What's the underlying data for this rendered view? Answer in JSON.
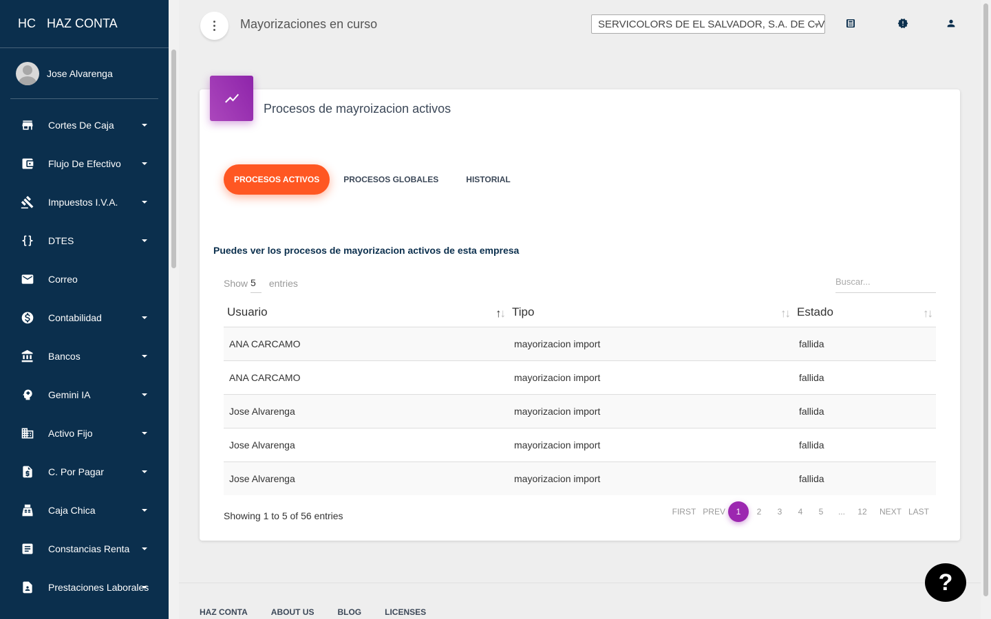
{
  "brand": {
    "mini": "HC",
    "name": "HAZ CONTA"
  },
  "user": {
    "name": "Jose Alvarenga"
  },
  "sidebar": {
    "items": [
      {
        "label": "Cortes De Caja",
        "icon": "store-icon",
        "caret": true
      },
      {
        "label": "Flujo De Efectivo",
        "icon": "wallet-icon",
        "caret": true
      },
      {
        "label": "Impuestos I.V.A.",
        "icon": "gavel-icon",
        "caret": true
      },
      {
        "label": "DTES",
        "icon": "braces-icon",
        "caret": true
      },
      {
        "label": "Correo",
        "icon": "mail-icon",
        "caret": false
      },
      {
        "label": "Contabilidad",
        "icon": "dollar-icon",
        "caret": true
      },
      {
        "label": "Bancos",
        "icon": "bank-icon",
        "caret": true
      },
      {
        "label": "Gemini IA",
        "icon": "brain-icon",
        "caret": true
      },
      {
        "label": "Activo Fijo",
        "icon": "building-icon",
        "caret": true
      },
      {
        "label": "C. Por Pagar",
        "icon": "invoice-icon",
        "caret": true
      },
      {
        "label": "Caja Chica",
        "icon": "register-icon",
        "caret": true
      },
      {
        "label": "Constancias Renta",
        "icon": "document-icon",
        "caret": true
      },
      {
        "label": "Prestaciones Laborales",
        "icon": "badge-icon",
        "caret": true
      }
    ]
  },
  "header": {
    "title": "Mayorizaciones en curso",
    "company": "SERVICOLORS DE EL SALVADOR, S.A. DE C.V."
  },
  "card": {
    "title": "Procesos de mayroizacion activos",
    "tabs": [
      "PROCESOS ACTIVOS",
      "PROCESOS GLOBALES",
      "HISTORIAL"
    ],
    "description": "Puedes ver los procesos de mayorizacion activos de esta empresa",
    "show_label": "Show",
    "show_count": "5",
    "entries_label": "entries",
    "search_placeholder": "Buscar..."
  },
  "table": {
    "headers": [
      "Usuario",
      "Tipo",
      "Estado"
    ],
    "rows": [
      [
        "ANA CARCAMO",
        "mayorizacion import",
        "fallida"
      ],
      [
        "ANA CARCAMO",
        "mayorizacion import",
        "fallida"
      ],
      [
        "Jose Alvarenga",
        "mayorizacion import",
        "fallida"
      ],
      [
        "Jose Alvarenga",
        "mayorizacion import",
        "fallida"
      ],
      [
        "Jose Alvarenga",
        "mayorizacion import",
        "fallida"
      ]
    ],
    "info": "Showing 1 to 5 of 56 entries"
  },
  "pagination": {
    "first": "FIRST",
    "prev": "PREV",
    "pages": [
      "1",
      "2",
      "3",
      "4",
      "5",
      "...",
      "12"
    ],
    "next": "NEXT",
    "last": "LAST",
    "active": "1"
  },
  "footer": {
    "links": [
      "HAZ CONTA",
      "ABOUT US",
      "BLOG",
      "LICENSES"
    ]
  },
  "help": {
    "label": "?"
  },
  "colors": {
    "sidebar": "#0b2f4d",
    "accent": "#ff5722",
    "purple": "#9c27b0"
  }
}
